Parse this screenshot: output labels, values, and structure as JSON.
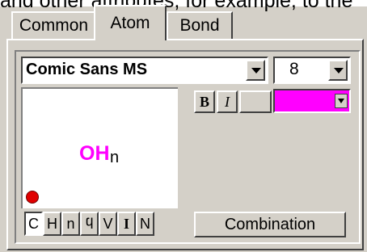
{
  "caption_fragment": "and other attributes, for example, to the",
  "tabs": [
    {
      "label": "Common"
    },
    {
      "label": "Atom"
    },
    {
      "label": "Bond"
    }
  ],
  "font_select": {
    "value": "Comic Sans MS"
  },
  "size_select": {
    "value": "8"
  },
  "format_buttons": {
    "bold": "B",
    "italic": "I"
  },
  "color_select": {
    "value": "#ff00ff"
  },
  "preview": {
    "label": "OH",
    "subscript": "n",
    "label_color": "#ff00ff",
    "dot_color": "#e00000"
  },
  "element_buttons": [
    {
      "label": "C",
      "pressed": true
    },
    {
      "label": "H",
      "pressed": false
    },
    {
      "label": "n",
      "pressed": false
    },
    {
      "label": "ϥ",
      "pressed": false
    },
    {
      "label": "V",
      "pressed": false
    },
    {
      "label": "I",
      "pressed": false
    },
    {
      "label": "N",
      "pressed": false
    }
  ],
  "combination_button": {
    "label": "Combination"
  }
}
